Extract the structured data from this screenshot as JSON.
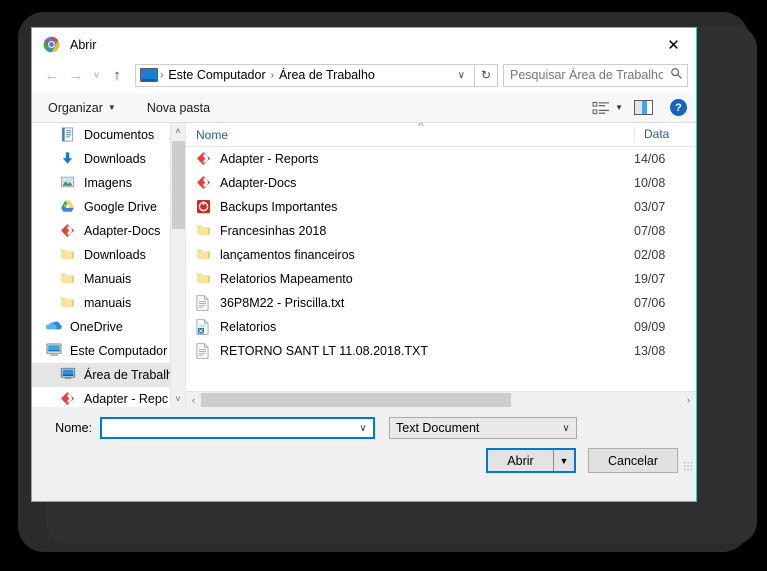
{
  "window": {
    "title": "Abrir",
    "app_icon": "chrome-icon",
    "close_label": "✕",
    "border_color": "#4cc2b0",
    "accent_color": "#0078d7"
  },
  "nav": {
    "back": "←",
    "forward": "→",
    "recent": "∨",
    "up": "↑",
    "refresh": "↻",
    "dropdown": "∨",
    "breadcrumbs": [
      {
        "label": "Este Computador"
      },
      {
        "label": "Área de Trabalho"
      }
    ],
    "separator": "›"
  },
  "search": {
    "placeholder": "Pesquisar Área de Trabalho",
    "value": "",
    "icon": "search-icon"
  },
  "toolbar": {
    "organize_label": "Organizar",
    "new_folder_label": "Nova pasta",
    "caret": "▼",
    "view_icon": "list-view-icon",
    "pane_icon": "preview-pane-icon",
    "help_icon": "help-icon",
    "help_glyph": "?"
  },
  "sidebar": {
    "items": [
      {
        "label": "Documentos",
        "icon": "documents-icon",
        "pinned": true,
        "indent": 1,
        "selected": false
      },
      {
        "label": "Downloads",
        "icon": "downloads-icon",
        "pinned": true,
        "indent": 1,
        "selected": false
      },
      {
        "label": "Imagens",
        "icon": "pictures-icon",
        "pinned": true,
        "indent": 1,
        "selected": false
      },
      {
        "label": "Google Drive",
        "icon": "google-drive-icon",
        "pinned": true,
        "indent": 1,
        "selected": false
      },
      {
        "label": "Adapter-Docs",
        "icon": "adapter-icon",
        "pinned": false,
        "indent": 1,
        "selected": false
      },
      {
        "label": "Downloads",
        "icon": "folder-icon",
        "pinned": false,
        "indent": 1,
        "selected": false
      },
      {
        "label": "Manuais",
        "icon": "folder-icon",
        "pinned": false,
        "indent": 1,
        "selected": false
      },
      {
        "label": "manuais",
        "icon": "folder-icon",
        "pinned": false,
        "indent": 1,
        "selected": false
      },
      {
        "label": "OneDrive",
        "icon": "onedrive-icon",
        "pinned": false,
        "indent": 0,
        "selected": false
      },
      {
        "label": "Este Computador",
        "icon": "this-pc-icon",
        "pinned": false,
        "indent": 0,
        "selected": false
      },
      {
        "label": "Área de Trabalho",
        "icon": "desktop-icon",
        "pinned": false,
        "indent": 1,
        "selected": true
      },
      {
        "label": "Adapter - Repc",
        "icon": "adapter-icon",
        "pinned": false,
        "indent": 1,
        "selected": false
      }
    ],
    "scroll_up": "˄",
    "scroll_down": "˅"
  },
  "filelist": {
    "columns": [
      {
        "label": "Nome"
      },
      {
        "label": "Data"
      }
    ],
    "sort_indicator": "˄",
    "rows": [
      {
        "name": "Adapter - Reports",
        "icon": "adapter-icon",
        "date": "14/06"
      },
      {
        "name": "Adapter-Docs",
        "icon": "adapter-icon",
        "date": "10/08"
      },
      {
        "name": "Backups Importantes",
        "icon": "backup-icon",
        "date": "03/07"
      },
      {
        "name": "Francesinhas 2018",
        "icon": "folder-icon",
        "date": "07/08"
      },
      {
        "name": "lançamentos financeiros",
        "icon": "folder-icon",
        "date": "02/08"
      },
      {
        "name": "Relatorios Mapeamento",
        "icon": "folder-icon",
        "date": "19/07"
      },
      {
        "name": "36P8M22 - Priscilla.txt",
        "icon": "text-file-icon",
        "date": "07/06"
      },
      {
        "name": "Relatorios",
        "icon": "excel-file-icon",
        "date": "09/09"
      },
      {
        "name": "RETORNO SANT LT 11.08.2018.TXT",
        "icon": "text-file-icon",
        "date": "13/08"
      }
    ],
    "h_scroll_left": "‹",
    "h_scroll_right": "›"
  },
  "footer": {
    "name_label": "Nome:",
    "name_value": "",
    "name_caret": "∨",
    "filetype_value": "Text Document",
    "filetype_caret": "∨",
    "open_label": "Abrir",
    "open_split_caret": "▼",
    "cancel_label": "Cancelar"
  }
}
